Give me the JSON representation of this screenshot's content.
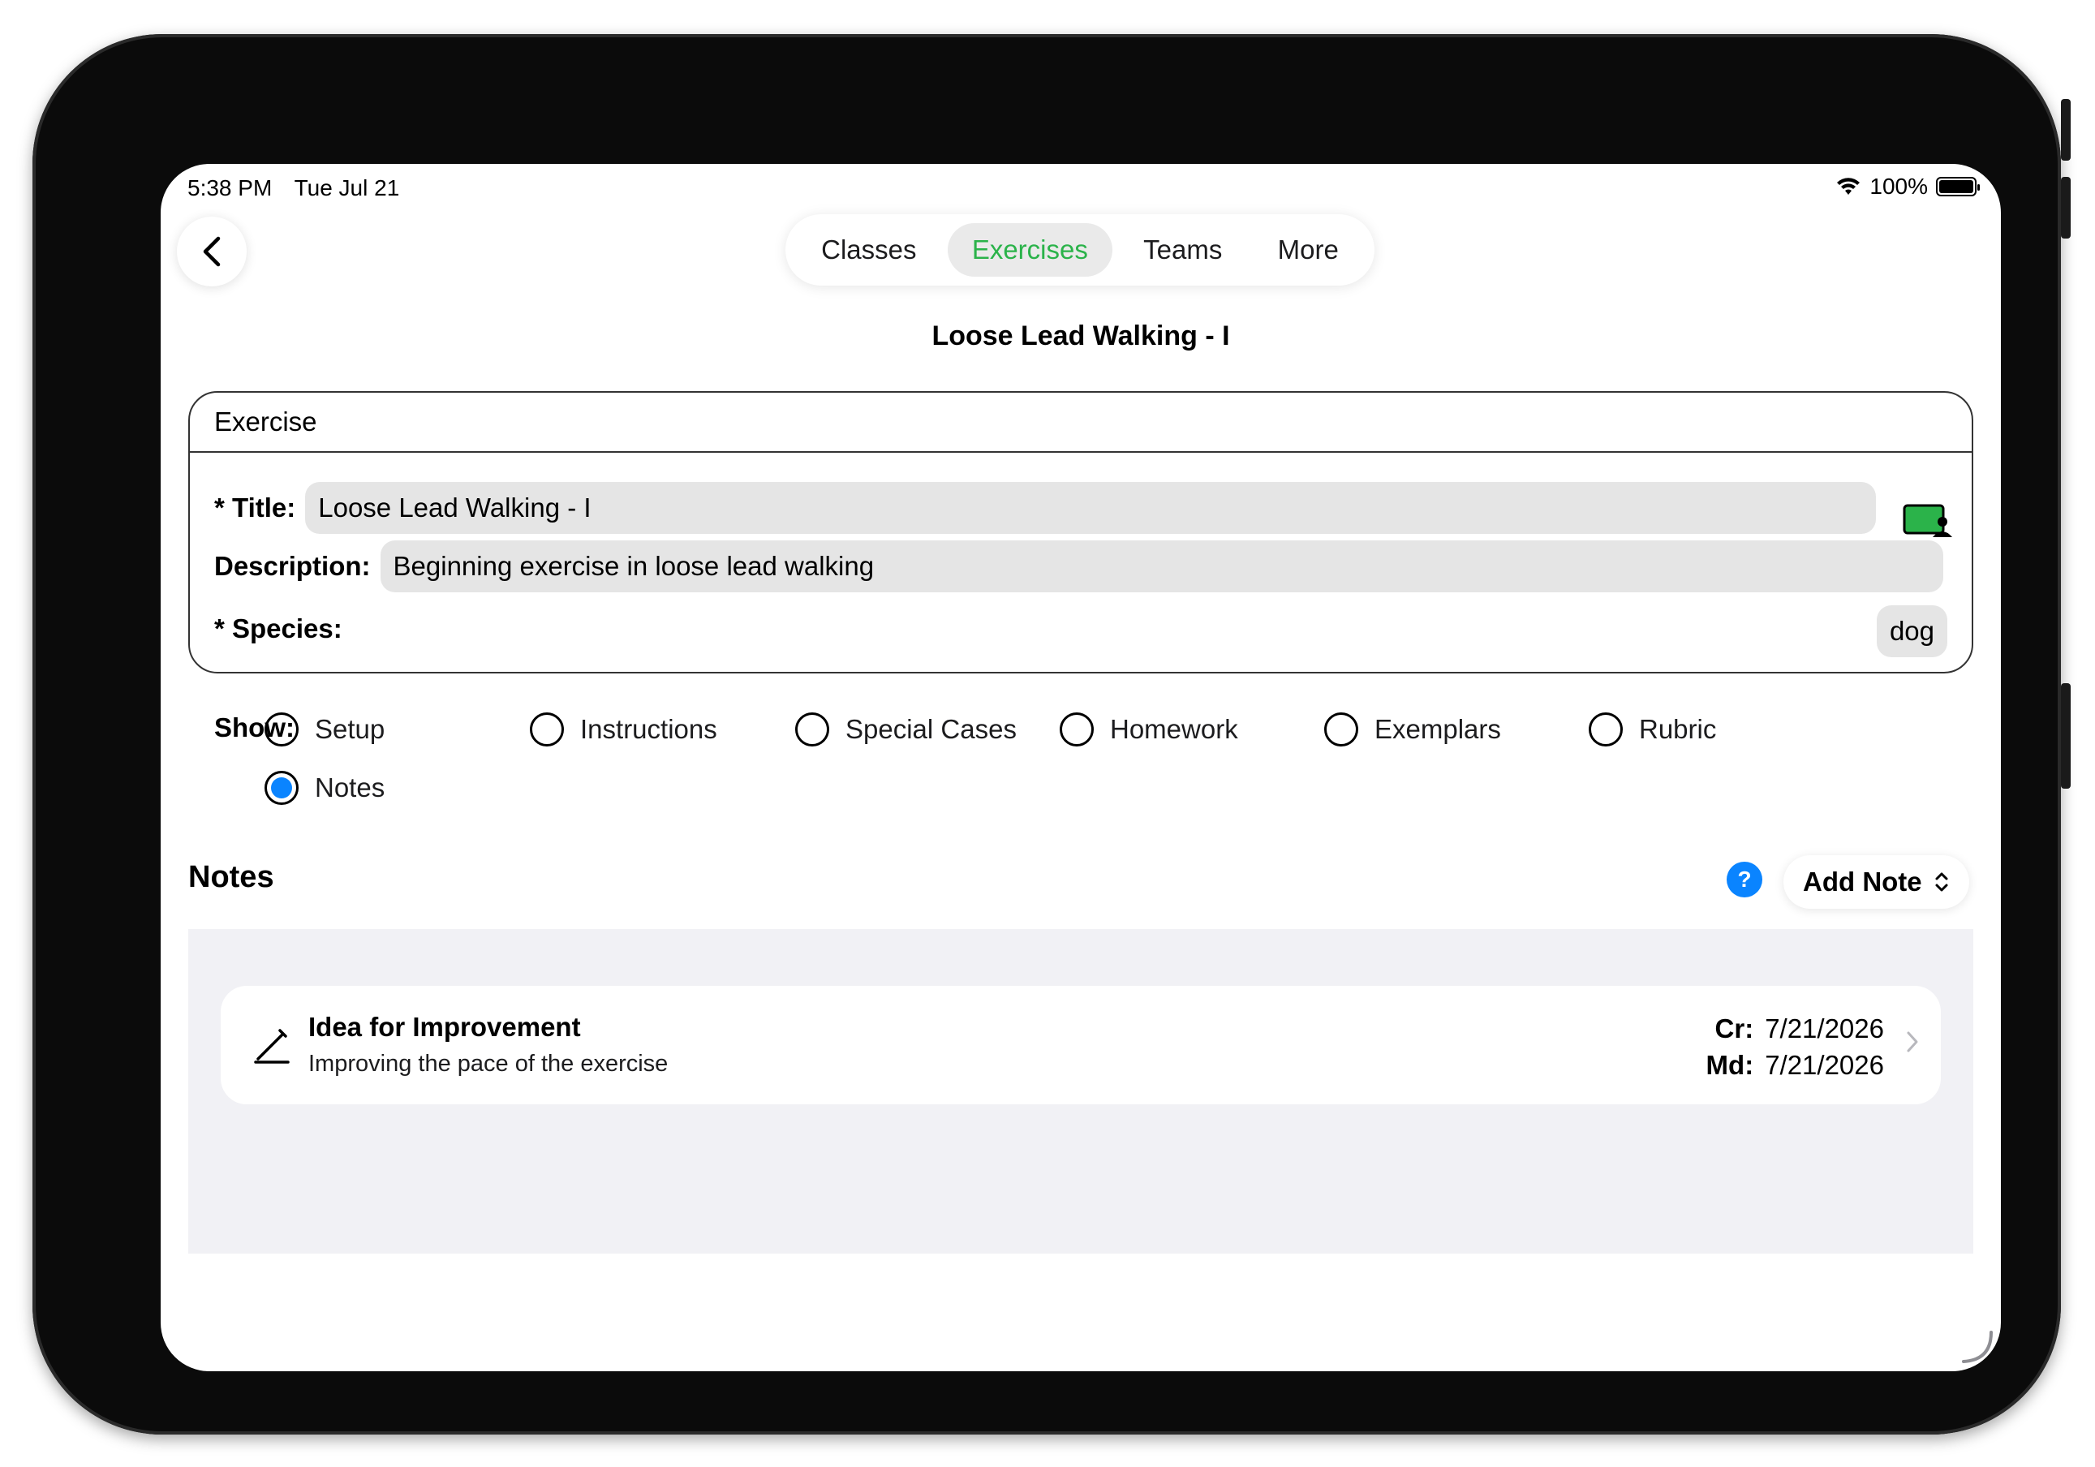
{
  "status": {
    "time": "5:38 PM",
    "date": "Tue Jul 21",
    "battery": "100%"
  },
  "tabs": [
    {
      "label": "Classes",
      "active": false
    },
    {
      "label": "Exercises",
      "active": true
    },
    {
      "label": "Teams",
      "active": false
    },
    {
      "label": "More",
      "active": false
    }
  ],
  "page_title": "Loose Lead Walking - I",
  "exercise": {
    "header": "Exercise",
    "title_label": "* Title:",
    "title_value": "Loose Lead Walking - I",
    "description_label": "Description:",
    "description_value": "Beginning exercise in loose lead walking",
    "species_label": "* Species:",
    "species_value": "dog"
  },
  "show": {
    "label": "Show:",
    "options": [
      {
        "label": "Setup",
        "selected": false
      },
      {
        "label": "Instructions",
        "selected": false
      },
      {
        "label": "Special Cases",
        "selected": false
      },
      {
        "label": "Homework",
        "selected": false
      },
      {
        "label": "Exemplars",
        "selected": false
      },
      {
        "label": "Rubric",
        "selected": false
      },
      {
        "label": "Notes",
        "selected": true
      }
    ]
  },
  "notes": {
    "title": "Notes",
    "help": "?",
    "add_label": "Add Note",
    "items": [
      {
        "title": "Idea for Improvement",
        "subtitle": "Improving the pace of the exercise",
        "created_label": "Cr:",
        "created": "7/21/2026",
        "modified_label": "Md:",
        "modified": "7/21/2026"
      }
    ]
  },
  "colors": {
    "accent_green": "#2bb34a",
    "accent_blue": "#0a84ff"
  }
}
